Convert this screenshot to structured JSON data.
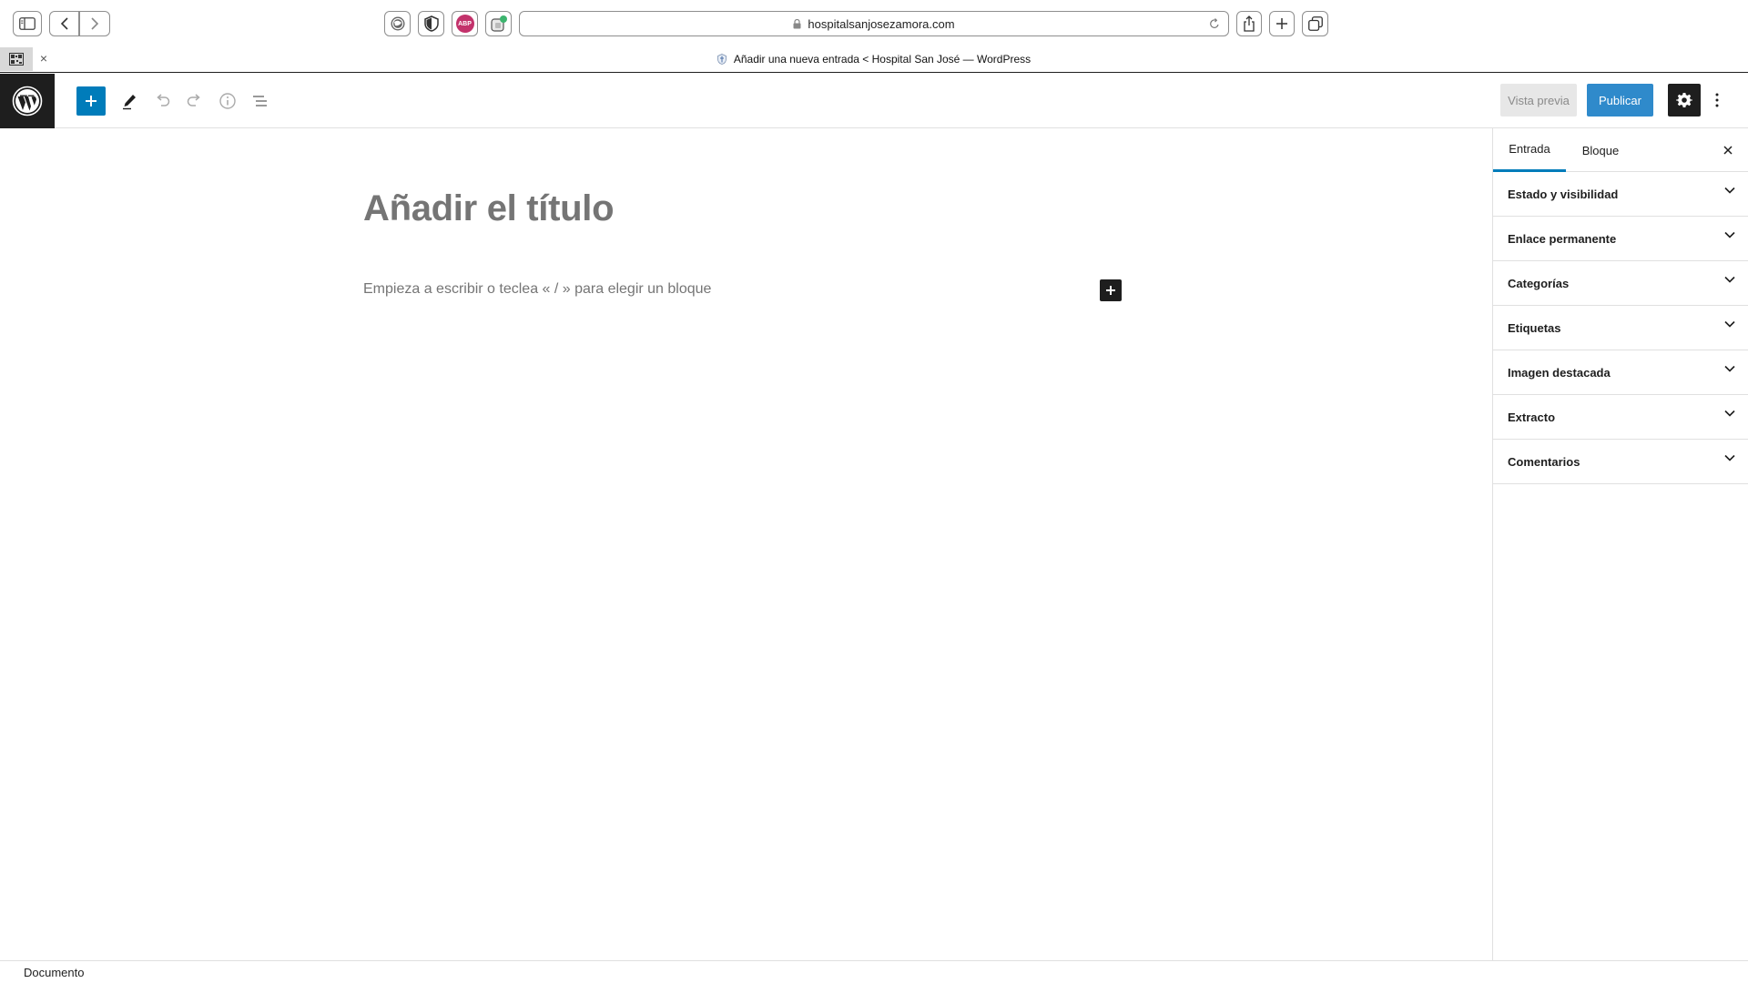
{
  "browser": {
    "url": "hospitalsanjosezamora.com",
    "tab_title": "Añadir una nueva entrada < Hospital San José — WordPress",
    "extensions": [
      "world-icon",
      "shield-icon",
      "adblock-icon",
      "extension-icon"
    ],
    "adblock_label": "ABP",
    "tab_close": "×"
  },
  "editor_header": {
    "preview_label": "Vista previa",
    "publish_label": "Publicar",
    "accent_color": "#007cba"
  },
  "canvas": {
    "title_placeholder": "Añadir el título",
    "block_placeholder": "Empieza a escribir o teclea « / » para elegir un bloque"
  },
  "sidebar": {
    "tabs": [
      {
        "label": "Entrada",
        "active": true
      },
      {
        "label": "Bloque",
        "active": false
      }
    ],
    "panels": [
      {
        "label": "Estado y visibilidad"
      },
      {
        "label": "Enlace permanente"
      },
      {
        "label": "Categorías"
      },
      {
        "label": "Etiquetas"
      },
      {
        "label": "Imagen destacada"
      },
      {
        "label": "Extracto"
      },
      {
        "label": "Comentarios"
      }
    ]
  },
  "footer": {
    "breadcrumb": "Documento"
  }
}
